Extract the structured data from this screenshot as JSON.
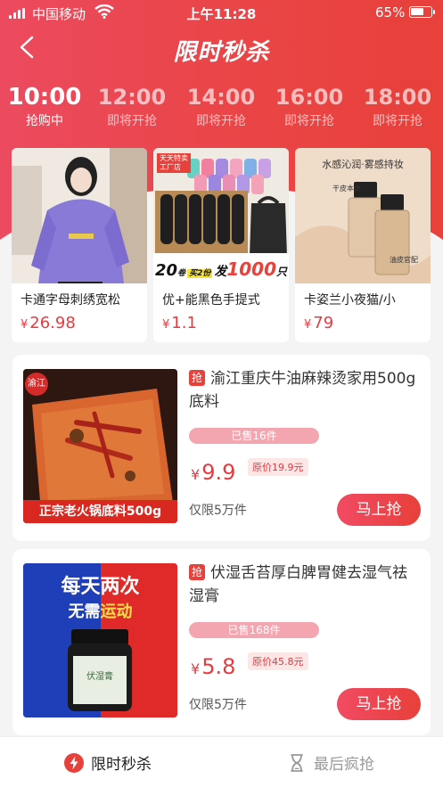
{
  "status": {
    "carrier": "中国移动",
    "time": "上午11:28",
    "battery": "65%"
  },
  "header": {
    "title": "限时秒杀"
  },
  "tabs": [
    {
      "time": "10:00",
      "status": "抢购中",
      "active": true
    },
    {
      "time": "12:00",
      "status": "即将开抢"
    },
    {
      "time": "14:00",
      "status": "即将开抢"
    },
    {
      "time": "16:00",
      "status": "即将开抢"
    },
    {
      "time": "18:00",
      "status": "即将开抢"
    }
  ],
  "top_products": [
    {
      "name": "卡通字母刺绣宽松",
      "currency": "¥",
      "price": "26.98"
    },
    {
      "name": "优+能黑色手提式",
      "currency": "¥",
      "price": "1.1",
      "img_badge": "天天特卖",
      "img_badge2": "工厂店",
      "img_promo_a": "20",
      "img_promo_b": "卷",
      "img_promo_c": "买2份",
      "img_promo_d": "发",
      "img_promo_e": "1000",
      "img_promo_f": "只"
    },
    {
      "name": "卡姿兰小夜猫/小",
      "currency": "¥",
      "price": "79",
      "img_text": "水感沁润·雾感持妆",
      "img_text2": "干皮本命",
      "img_text3": "油皮官配"
    }
  ],
  "items": [
    {
      "tag": "抢",
      "title": "渝江重庆牛油麻辣烫家用500g底料",
      "sold": "已售16件",
      "currency": "¥",
      "price": "9.9",
      "original": "原价19.9元",
      "limit": "仅限5万件",
      "button": "马上抢",
      "img_caption": "正宗老火锅底料500g",
      "img_brand": "渝江"
    },
    {
      "tag": "抢",
      "title": "伏湿舌苔厚白脾胃健去湿气祛湿膏",
      "sold": "已售168件",
      "currency": "¥",
      "price": "5.8",
      "original": "原价45.8元",
      "limit": "仅限5万件",
      "button": "马上抢",
      "img_l1a": "每天",
      "img_l1b": "两次",
      "img_l2a": "无需",
      "img_l2b": "运动",
      "img_jar": "伏湿膏"
    }
  ],
  "bottom_nav": [
    {
      "label": "限时秒杀",
      "icon": "lightning-icon",
      "active": true
    },
    {
      "label": "最后疯抢",
      "icon": "hourglass-icon"
    }
  ],
  "colors": {
    "accent": "#e8403a",
    "header_start": "#ec4a5f",
    "price": "#e83a3f"
  }
}
